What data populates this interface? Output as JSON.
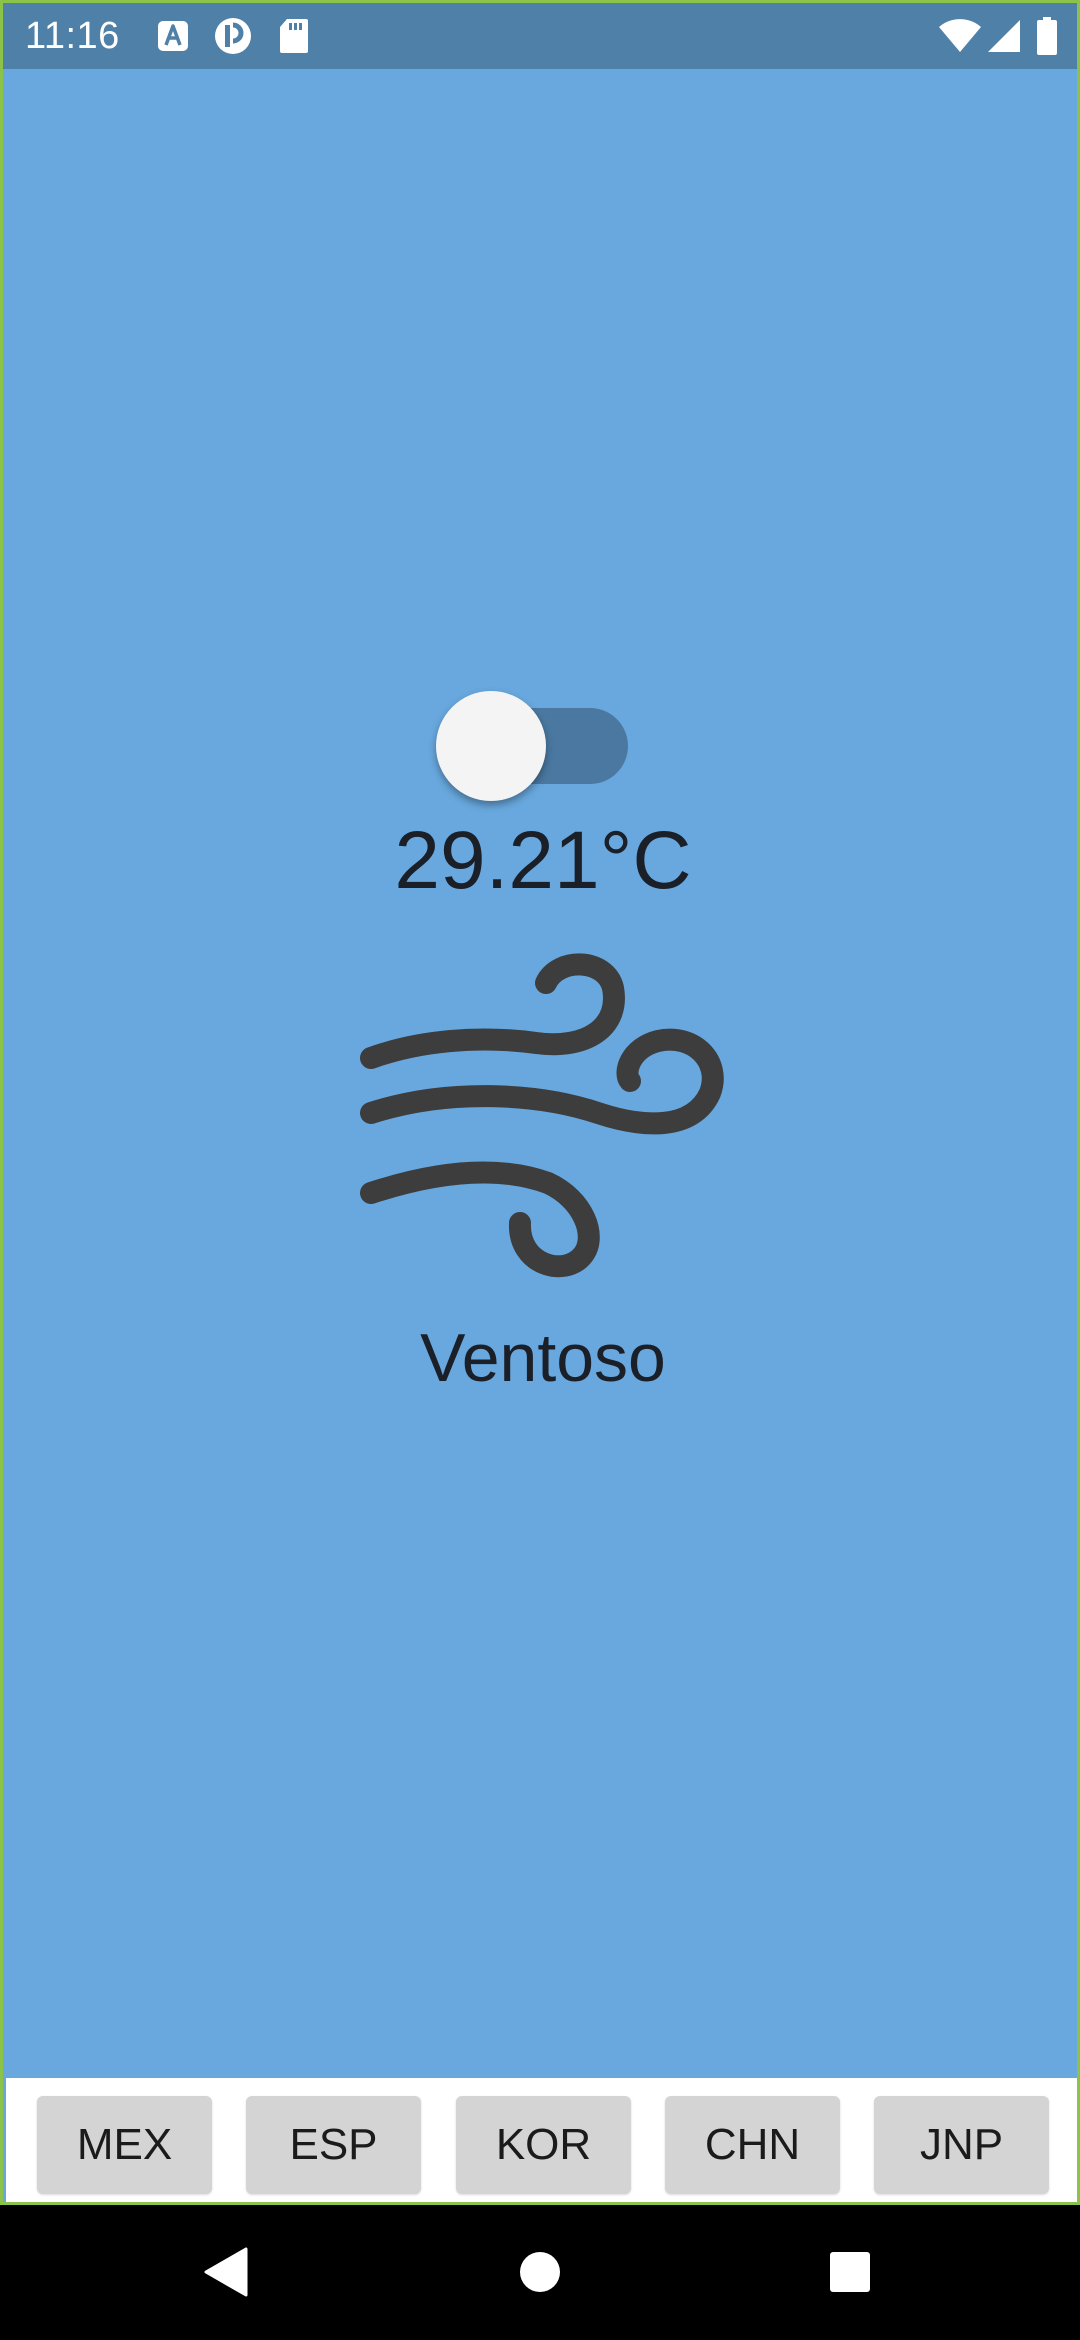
{
  "status_bar": {
    "time": "11:16",
    "icons": [
      "font-a-icon",
      "circle-p-icon",
      "sd-card-icon",
      "wifi-icon",
      "signal-icon",
      "battery-icon"
    ]
  },
  "weather": {
    "unit_toggle": {
      "state": "off"
    },
    "temperature": "29.21°C",
    "icon": "wind-icon",
    "condition": "Ventoso"
  },
  "country_tabs": [
    {
      "label": "MEX"
    },
    {
      "label": "ESP"
    },
    {
      "label": "KOR"
    },
    {
      "label": "CHN"
    },
    {
      "label": "JNP"
    }
  ],
  "nav_bar": {
    "icons": [
      "back-icon",
      "home-icon",
      "recents-icon"
    ]
  },
  "colors": {
    "background": "#68a8de",
    "status_bar": "#4f80a8",
    "text": "#1b1f28",
    "icon": "#3d3d3d",
    "tab_button": "#d4d4d4"
  }
}
